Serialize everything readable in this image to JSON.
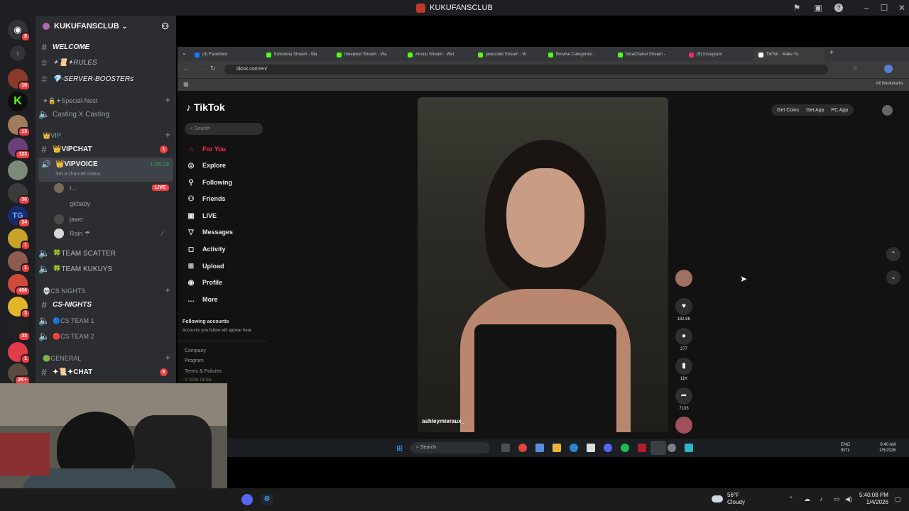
{
  "titlebar": {
    "title": "KUKUFANSCLUB"
  },
  "rail": {
    "badges": [
      "8",
      "10",
      "13",
      "123",
      "36",
      "34",
      "1",
      "1",
      "456",
      "3",
      "33",
      "1",
      "2K+"
    ]
  },
  "server": {
    "name": "KUKUFANSCLUB",
    "channels": [
      {
        "name": "WELCOME",
        "style": "bold"
      },
      {
        "name": "✦📜✦RULES",
        "style": "normal"
      },
      {
        "name": "💎-SERVER-BOOSTERs",
        "style": "bold"
      }
    ],
    "special_nest": {
      "category": "✦🔒✦Special-Nest",
      "channel": "Casting X Casting"
    },
    "vip": {
      "category": "👑VIP",
      "vipchat": "👑VIPCHAT",
      "vipchat_badge": "1",
      "vipvoice": "👑VIPVOICE",
      "vipvoice_time": "1:06:29",
      "vipvoice_status": "Set a channel status",
      "users": [
        {
          "name": "t...",
          "live": "LIVE"
        },
        {
          "name": "gkbaby"
        },
        {
          "name": "jawo"
        },
        {
          "name": "Rain ☂"
        }
      ]
    },
    "teams": [
      "🍀TEAM SCATTER",
      "🍀TEAM KUKUYS"
    ],
    "cs_nights": {
      "category": "💀CS NIGHTS",
      "channel": "CS-NIGHTS",
      "voice": [
        "🔵CS TEAM 1",
        "🔴CS TEAM 2"
      ]
    },
    "general": {
      "category": "🟢GENERAL",
      "channel": "✦📜✦CHAT",
      "badge": "9"
    }
  },
  "browser": {
    "tabs": [
      {
        "label": "(4) Facebook",
        "color": "#1877f2"
      },
      {
        "label": "Kokodota Stream - Wa",
        "color": "#53fc18"
      },
      {
        "label": "meepwet Stream - Wa",
        "color": "#53fc18"
      },
      {
        "label": "Anuuu Stream - Wat",
        "color": "#53fc18"
      },
      {
        "label": "jawocolet Stream - W",
        "color": "#53fc18"
      },
      {
        "label": "Browse Categories -",
        "color": "#53fc18"
      },
      {
        "label": "NicaChanel Stream -",
        "color": "#53fc18"
      },
      {
        "label": "(9) Instagram",
        "color": "#e1306c"
      },
      {
        "label": "TikTok - Make Yo",
        "color": "#ffffff"
      }
    ],
    "url": "tiktok.com/en/",
    "all_bookmarks": "All Bookmarks"
  },
  "tiktok": {
    "brand": "TikTok",
    "search_placeholder": "Search",
    "nav": [
      {
        "label": "For You",
        "icon": "home-icon"
      },
      {
        "label": "Explore",
        "icon": "compass-icon"
      },
      {
        "label": "Following",
        "icon": "following-icon"
      },
      {
        "label": "Friends",
        "icon": "friends-icon"
      },
      {
        "label": "LIVE",
        "icon": "live-icon"
      },
      {
        "label": "Messages",
        "icon": "send-icon"
      },
      {
        "label": "Activity",
        "icon": "bell-icon"
      },
      {
        "label": "Upload",
        "icon": "plus-icon"
      },
      {
        "label": "Profile",
        "icon": "profile-icon"
      },
      {
        "label": "More",
        "icon": "more-icon"
      }
    ],
    "following_title": "Following accounts",
    "following_sub": "Accounts you follow will appear here",
    "footer": [
      "Company",
      "Program",
      "Terms & Policies",
      "© 2026 TikTok"
    ],
    "top_actions": [
      "Get Coins",
      "Get App",
      "PC App"
    ],
    "video_user": "ashleymieraux_",
    "counts": {
      "likes": "182.8K",
      "comments": "277",
      "saves": "11K",
      "shares": "7103"
    }
  },
  "inner_taskbar": {
    "search": "Search",
    "lang": "ENG",
    "lang2": "INTL",
    "time": "9:40 AM",
    "date": "1/5/2026"
  },
  "taskbar": {
    "temp": "56°F",
    "weather": "Cloudy",
    "time": "5:40:08 PM",
    "date": "1/4/2026"
  }
}
